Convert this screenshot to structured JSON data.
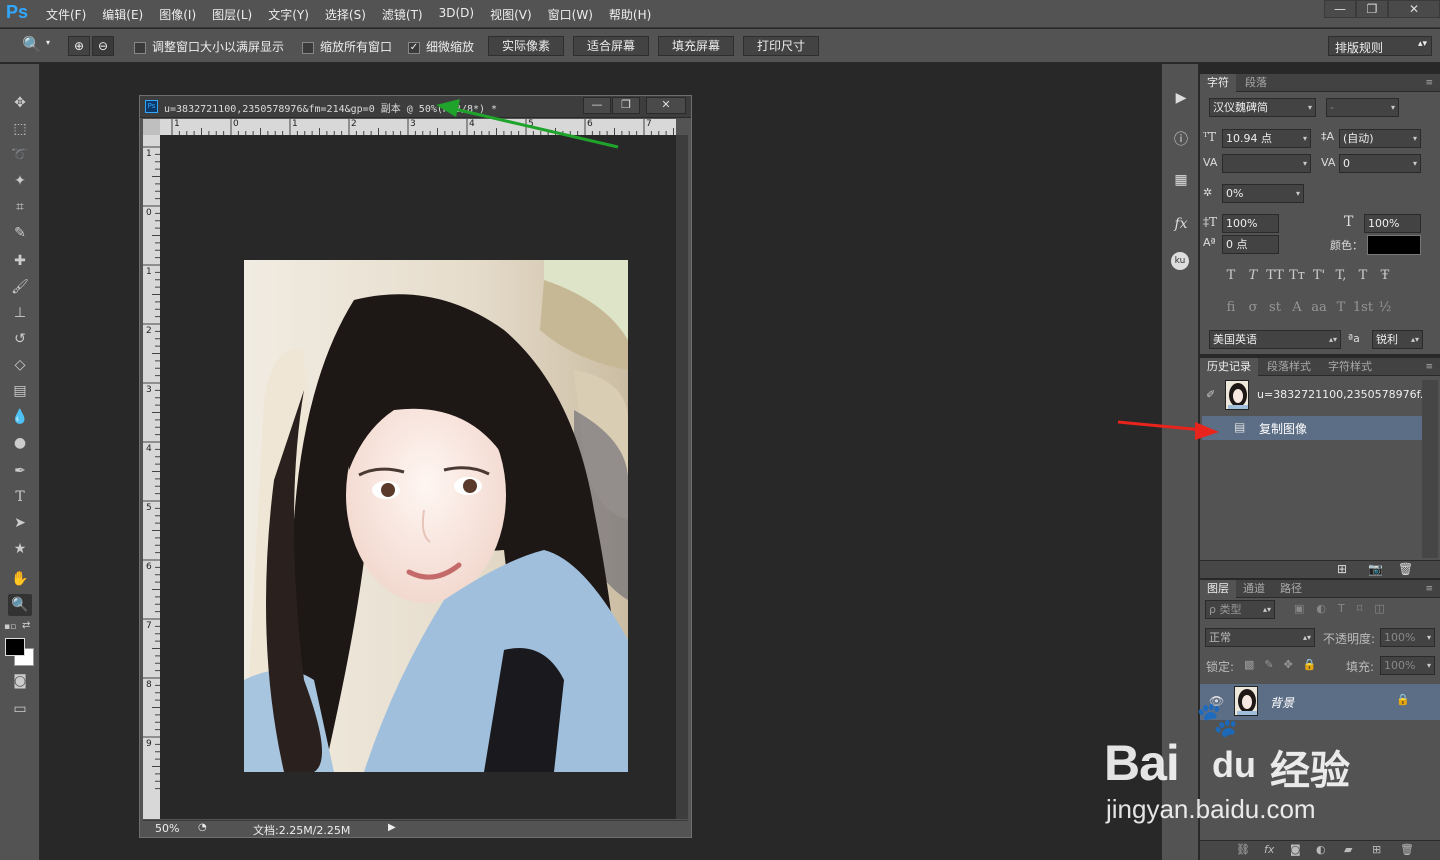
{
  "app": {
    "logo": "Ps"
  },
  "menu": [
    "文件(F)",
    "编辑(E)",
    "图像(I)",
    "图层(L)",
    "文字(Y)",
    "选择(S)",
    "滤镜(T)",
    "3D(D)",
    "视图(V)",
    "窗口(W)",
    "帮助(H)"
  ],
  "window_controls": {
    "minimize": "—",
    "restore": "❐",
    "close": "✕"
  },
  "options": {
    "resize_windows": "调整窗口大小以满屏显示",
    "zoom_all": "缩放所有窗口",
    "scrubby_zoom": "细微缩放",
    "scrubby_checked": "✓",
    "actual_pixels": "实际像素",
    "fit_screen": "适合屏幕",
    "fill_screen": "填充屏幕",
    "print_size": "打印尺寸",
    "workspace": "排版规则"
  },
  "document": {
    "title": "u=3832721100,2350578976&fm=214&gp=0 副本 @ 50%(RGB/8*) *",
    "zoom": "50%",
    "doc_size": "文档:2.25M/2.25M",
    "hruler": [
      "1",
      "0",
      "1",
      "2",
      "3",
      "4",
      "5",
      "6",
      "7"
    ],
    "vruler": [
      "1",
      "0",
      "1",
      "2",
      "3",
      "4",
      "5",
      "6",
      "7",
      "8",
      "9"
    ]
  },
  "character_panel": {
    "tabs": [
      "字符",
      "段落"
    ],
    "font": "汉仪魏碑简",
    "style": "-",
    "size": "10.94 点",
    "leading": "(自动)",
    "kerning": "",
    "tracking": "0",
    "tsume": "0%",
    "vscale": "100%",
    "hscale": "100%",
    "baseline": "0 点",
    "color_label": "颜色：",
    "color": "#000000",
    "styles": [
      "T",
      "T",
      "TT",
      "Tт",
      "T'",
      "T,",
      "T",
      "Ŧ"
    ],
    "opentype": [
      "fi",
      "σ",
      "st",
      "A",
      "aa",
      "T",
      "1st",
      "½"
    ],
    "language": "美国英语",
    "aa_icon": "ªa",
    "antialias": "锐利"
  },
  "history_panel": {
    "tabs": [
      "历史记录",
      "段落样式",
      "字符样式"
    ],
    "snapshot": "u=3832721100,2350578976f...",
    "states": [
      "复制图像"
    ]
  },
  "layers_panel": {
    "tabs": [
      "图层",
      "通道",
      "路径"
    ],
    "filter": "ρ 类型",
    "blend": "正常",
    "opacity_label": "不透明度:",
    "opacity": "100%",
    "lock_label": "锁定:",
    "fill_label": "填充:",
    "fill": "100%",
    "layers": [
      {
        "name": "背景"
      }
    ]
  },
  "watermark": {
    "brand": "Bai",
    "du": "du",
    "cn": "经验",
    "url": "jingyan.baidu.com"
  },
  "colors": {
    "accent": "#31a8ff",
    "arrow_green": "#1fa32a",
    "arrow_red": "#e8241c",
    "selected_row": "#5c6e86"
  }
}
